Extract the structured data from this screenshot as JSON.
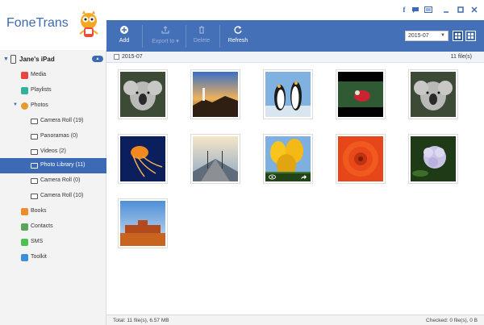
{
  "app": {
    "title": "FoneTrans"
  },
  "device": {
    "name": "Jane's iPad"
  },
  "sidebar": {
    "items": [
      {
        "label": "Media",
        "color": "#e8453c"
      },
      {
        "label": "Playlists",
        "color": "#2fb39a"
      },
      {
        "label": "Photos",
        "color": "#e79a2d"
      },
      {
        "label": "Camera Roll (19)"
      },
      {
        "label": "Panoramas (0)"
      },
      {
        "label": "Videos (2)"
      },
      {
        "label": "Photo Library (11)"
      },
      {
        "label": "Camera Roll (0)"
      },
      {
        "label": "Camera Roll (10)"
      },
      {
        "label": "Books",
        "color": "#f08b2c"
      },
      {
        "label": "Contacts",
        "color": "#5aa55a"
      },
      {
        "label": "SMS",
        "color": "#4fbf55"
      },
      {
        "label": "Toolkit",
        "color": "#3d8fd8"
      }
    ]
  },
  "toolbar": {
    "add": "Add",
    "export": "Export to",
    "delete": "Delete",
    "refresh": "Refresh",
    "date": "2015-07"
  },
  "group": {
    "label": "2015-07",
    "count": "11 file(s)"
  },
  "status": {
    "total": "Total: 11 file(s), 6.57 MB",
    "checked": "Checked: 0 file(s), 0 B"
  },
  "icons": {
    "facebook": "facebook-icon",
    "chat": "chat-icon",
    "menu": "menu-icon",
    "minimize": "minimize-icon",
    "maximize": "maximize-icon",
    "close": "close-icon",
    "view_overlay": "eye-icon",
    "share_overlay": "share-icon"
  },
  "colors": {
    "accent": "#4470b7",
    "selected": "#3d6ab4"
  }
}
